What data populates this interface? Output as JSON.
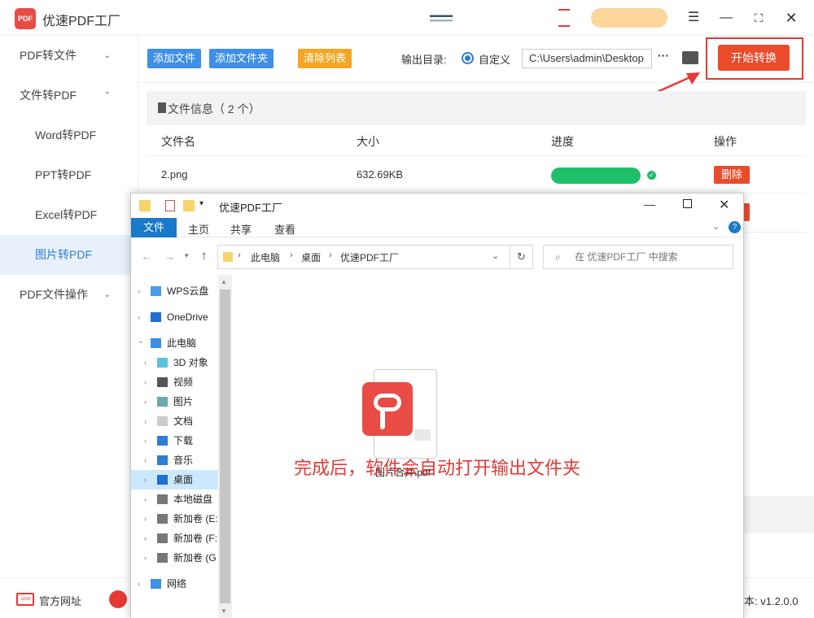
{
  "app": {
    "title": "优速PDF工厂",
    "logo_text": "PDF",
    "version": "v1.2.0.0",
    "version_prefix": "本:"
  },
  "sidebar": {
    "items": [
      {
        "label": "PDF转文件",
        "chevron": "⌄"
      },
      {
        "label": "文件转PDF",
        "chevron": "⌃"
      },
      {
        "label": "Word转PDF"
      },
      {
        "label": "PPT转PDF"
      },
      {
        "label": "Excel转PDF"
      },
      {
        "label": "图片转PDF"
      },
      {
        "label": "PDF文件操作",
        "chevron": "⌄"
      }
    ],
    "official_site": "官方网址"
  },
  "toolbar": {
    "add_file": "添加文件",
    "add_folder": "添加文件夹",
    "clear_list": "清除列表",
    "output_label": "输出目录:",
    "custom_label": "自定义",
    "output_path": "C:\\Users\\admin\\Desktop",
    "more": "···",
    "start": "开始转换"
  },
  "file_panel": {
    "title": "文件信息（ 2 个）",
    "columns": [
      "文件名",
      "大小",
      "进度",
      "操作"
    ],
    "rows": [
      {
        "name": "2.png",
        "size": "632.69KB",
        "progress": 1.0,
        "action": "删除"
      }
    ]
  },
  "explorer": {
    "title": "优速PDF工厂",
    "ribbon": [
      "文件",
      "主页",
      "共享",
      "查看"
    ],
    "breadcrumb": [
      "此电脑",
      "桌面",
      "优速PDF工厂"
    ],
    "search_placeholder": "在 优速PDF工厂 中搜索",
    "nav": [
      {
        "label": "WPS云盘"
      },
      {
        "label": "OneDrive"
      },
      {
        "label": "此电脑"
      },
      {
        "label": "3D 对象"
      },
      {
        "label": "视频"
      },
      {
        "label": "图片"
      },
      {
        "label": "文档"
      },
      {
        "label": "下载"
      },
      {
        "label": "音乐"
      },
      {
        "label": "桌面"
      },
      {
        "label": "本地磁盘"
      },
      {
        "label": "新加卷 (E:"
      },
      {
        "label": "新加卷 (F:"
      },
      {
        "label": "新加卷 (G"
      },
      {
        "label": "网络"
      }
    ],
    "file": {
      "name": "图片合并.pdf"
    }
  },
  "annotation": "完成后，软件会自动打开输出文件夹",
  "colors": {
    "accent": "#3d8fe8",
    "danger": "#e94b2b",
    "orange": "#f5a623",
    "progress": "#1fbf6a"
  }
}
